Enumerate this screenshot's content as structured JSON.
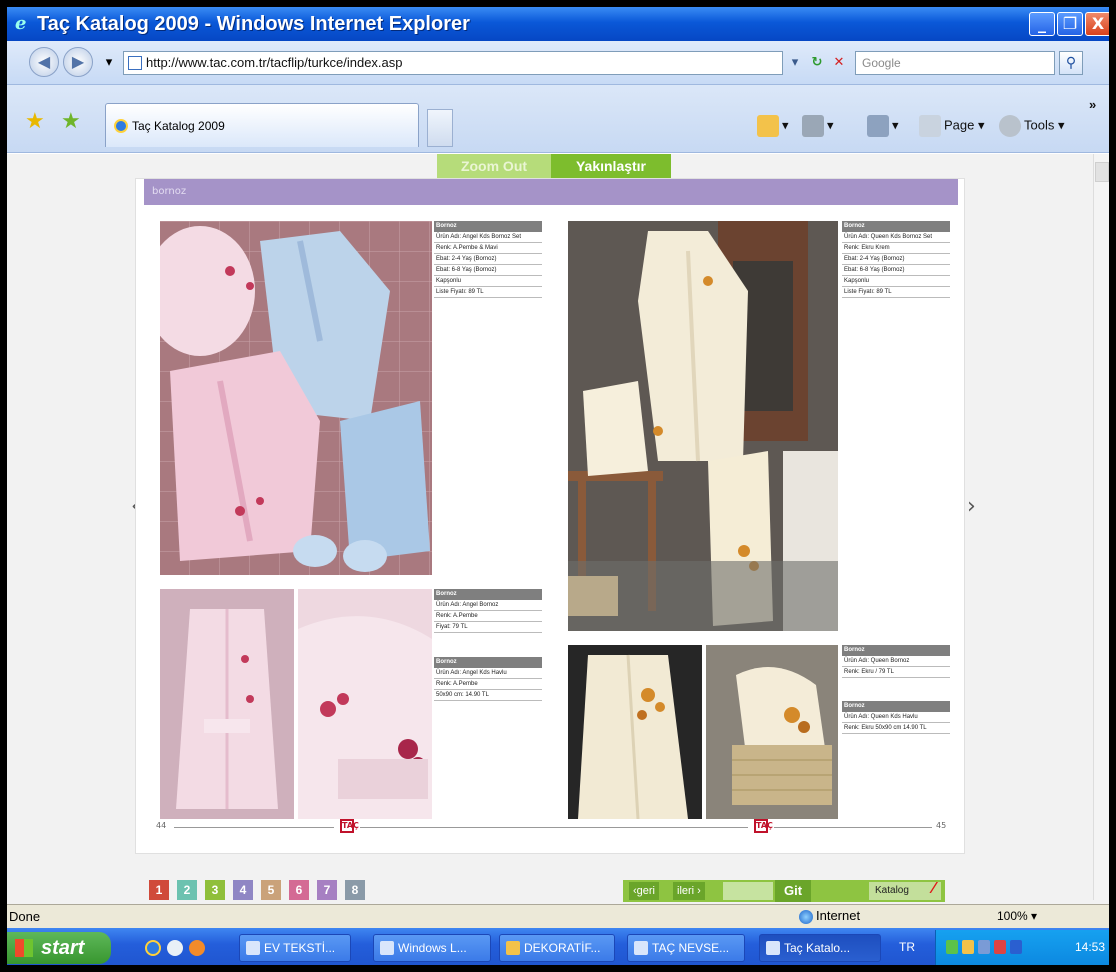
{
  "window": {
    "title": "Taç Katalog 2009 - Windows Internet Explorer",
    "min_label": "_",
    "max_label": "❐",
    "close_label": "X"
  },
  "address": {
    "url": "http://www.tac.com.tr/tacflip/turkce/index.asp",
    "search_placeholder": "Google"
  },
  "tab": {
    "label": "Taç Katalog 2009"
  },
  "toolbar": {
    "page_label": "Page ▾",
    "tools_label": "Tools ▾",
    "more_label": "»"
  },
  "viewer": {
    "zoom_out_label": "Zoom Out",
    "zoom_in_label": "Yakınlaştır",
    "header_label": "bornoz",
    "left_arrow": "‹",
    "right_arrow": "›",
    "foot_left_num": "44",
    "foot_right_num": "45",
    "logo_text": "TAÇ"
  },
  "infoboxes": [
    {
      "header": "Bornoz",
      "rows": [
        "Ürün Adı: Angel Kds Bornoz Set",
        "Renk: A.Pembe & Mavi",
        "Ebat: 2-4 Yaş (Bornoz)",
        "Ebat: 6-8 Yaş (Bornoz)",
        "Kapşonlu",
        "Liste Fiyatı: 89 TL"
      ]
    },
    {
      "header": "Bornoz",
      "rows": [
        "Ürün Adı: Angel Bornoz",
        "Renk: A.Pembe",
        "Fiyat: 79 TL"
      ]
    },
    {
      "header": "Bornoz",
      "rows": [
        "Ürün Adı: Angel Kds Havlu",
        "Renk: A.Pembe",
        "50x90 cm: 14.90 TL"
      ]
    },
    {
      "header": "Bornoz",
      "rows": [
        "Ürün Adı: Queen Kds Bornoz Set",
        "Renk: Ekru Krem",
        "Ebat: 2-4 Yaş (Bornoz)",
        "Ebat: 6-8 Yaş (Bornoz)",
        "Kapşonlu",
        "Liste Fiyatı: 89 TL"
      ]
    },
    {
      "header": "Bornoz",
      "rows": [
        "Ürün Adı: Queen Bornoz",
        "Renk: Ekru / 79 TL"
      ]
    },
    {
      "header": "Bornoz",
      "rows": [
        "Ürün Adı: Queen Kds Havlu",
        "Renk: Ekru 50x90 cm 14.90 TL"
      ]
    }
  ],
  "pages": [
    "1",
    "2",
    "3",
    "4",
    "5",
    "6",
    "7",
    "8"
  ],
  "page_colors": [
    "#d04a3a",
    "#6cc2b0",
    "#8fbf3a",
    "#8f86c4",
    "#caa27a",
    "#d46a94",
    "#a680c2",
    "#8a9aa8"
  ],
  "nav": {
    "prev_label": "‹geri",
    "next_label": "ileri ›",
    "go_label": "Git",
    "catalog_label": "Katalog",
    "pdf_label": "⁄"
  },
  "status": {
    "text": "Done",
    "zone": "Internet",
    "zoom": "100%  ▾"
  },
  "taskbar": {
    "start_label": "start",
    "tasks": [
      "EV TEKSTİ...",
      "Windows L...",
      "DEKORATİF...",
      "TAÇ NEVSE...",
      "Taç Katalo..."
    ],
    "lang": "TR",
    "clock": "14:53"
  }
}
